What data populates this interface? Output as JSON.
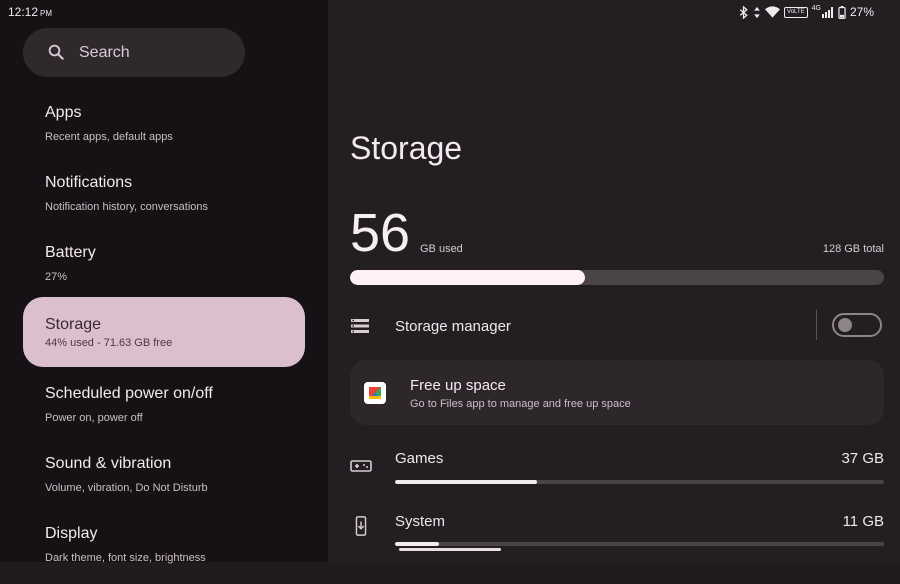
{
  "status_bar": {
    "time": "12:12",
    "ampm": "PM",
    "battery": "27%",
    "volte": "VoLTE",
    "network": "4G"
  },
  "search": {
    "label": "Search"
  },
  "sidebar": {
    "items": [
      {
        "title": "Apps",
        "subtitle": "Recent apps, default apps"
      },
      {
        "title": "Notifications",
        "subtitle": "Notification history, conversations"
      },
      {
        "title": "Battery",
        "subtitle": "27%"
      },
      {
        "title": "Storage",
        "subtitle": "44% used - 71.63 GB free"
      },
      {
        "title": "Scheduled power on/off",
        "subtitle": "Power on, power off"
      },
      {
        "title": "Sound & vibration",
        "subtitle": "Volume, vibration, Do Not Disturb"
      },
      {
        "title": "Display",
        "subtitle": "Dark theme, font size, brightness"
      }
    ]
  },
  "storage": {
    "title": "Storage",
    "used_value": "56",
    "used_unit": "GB used",
    "total": "128 GB total",
    "used_fraction": 0.44,
    "manager": {
      "label": "Storage manager",
      "enabled": false
    },
    "free_up": {
      "title": "Free up space",
      "subtitle": "Go to Files app to manage and free up space"
    },
    "categories": [
      {
        "label": "Games",
        "value": "37 GB",
        "fraction": 0.29
      },
      {
        "label": "System",
        "value": "11 GB",
        "fraction": 0.09
      }
    ]
  },
  "colors": {
    "accent": "#dcbfcf",
    "bar_fill": "#fff0f6",
    "track": "#4a4348"
  }
}
